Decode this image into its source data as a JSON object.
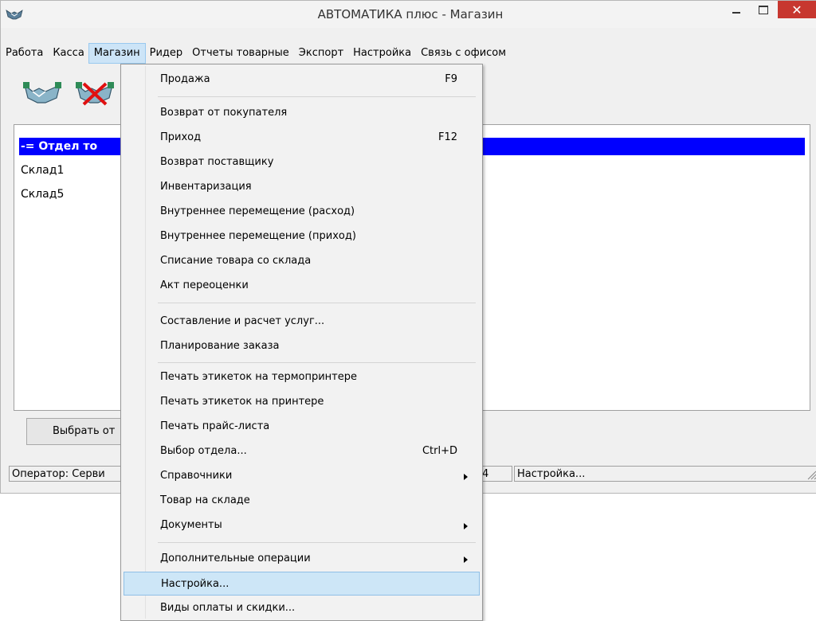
{
  "window": {
    "title": "АВТОМАТИКА плюс - Магазин",
    "close_glyph": "✕"
  },
  "menubar": {
    "items": [
      "Работа",
      "Касса",
      "Магазин",
      "Ридер",
      "Отчеты товарные",
      "Экспорт",
      "Настройка",
      "Связь с офисом"
    ],
    "active": "Магазин"
  },
  "toolbar": {
    "buttons": [
      {
        "icon": "handshake-icon"
      },
      {
        "icon": "handshake-cancel-icon"
      }
    ]
  },
  "list": {
    "items": [
      {
        "label": "-= Отдел то",
        "selected": true
      },
      {
        "label": "Склад1",
        "selected": false
      },
      {
        "label": "Склад5",
        "selected": false
      }
    ]
  },
  "buttons": {
    "pick": "Выбрать от"
  },
  "statusbar": {
    "operator": "Оператор: Серви",
    "num": "4",
    "setting": "Настройка..."
  },
  "dropdown": {
    "items": [
      {
        "label": "Продажа",
        "shortcut": "F9"
      },
      {
        "label": "Возврат от покупателя"
      },
      {
        "label": "Приход",
        "shortcut": "F12"
      },
      {
        "label": "Возврат поставщику"
      },
      {
        "label": "Инвентаризация"
      },
      {
        "label": "Внутреннее перемещение (расход)"
      },
      {
        "label": "Внутреннее перемещение (приход)"
      },
      {
        "label": "Списание товара со склада"
      },
      {
        "label": "Акт переоценки"
      },
      {
        "label": "Составление и расчет услуг..."
      },
      {
        "label": "Планирование заказа"
      },
      {
        "label": "Печать этикеток на термопринтере"
      },
      {
        "label": "Печать этикеток на принтере"
      },
      {
        "label": "Печать прайс-листа"
      },
      {
        "label": "Выбор отдела...",
        "shortcut": "Ctrl+D"
      },
      {
        "label": "Справочники",
        "submenu": true
      },
      {
        "label": "Товар на складе"
      },
      {
        "label": "Документы",
        "submenu": true
      },
      {
        "label": "Дополнительные операции",
        "submenu": true
      },
      {
        "label": "Настройка...",
        "highlighted": true
      },
      {
        "label": "Виды оплаты и скидки..."
      }
    ]
  },
  "colors": {
    "selection": "#0000ff",
    "close_button": "#c7372f",
    "menu_highlight": "#cde6f7"
  }
}
